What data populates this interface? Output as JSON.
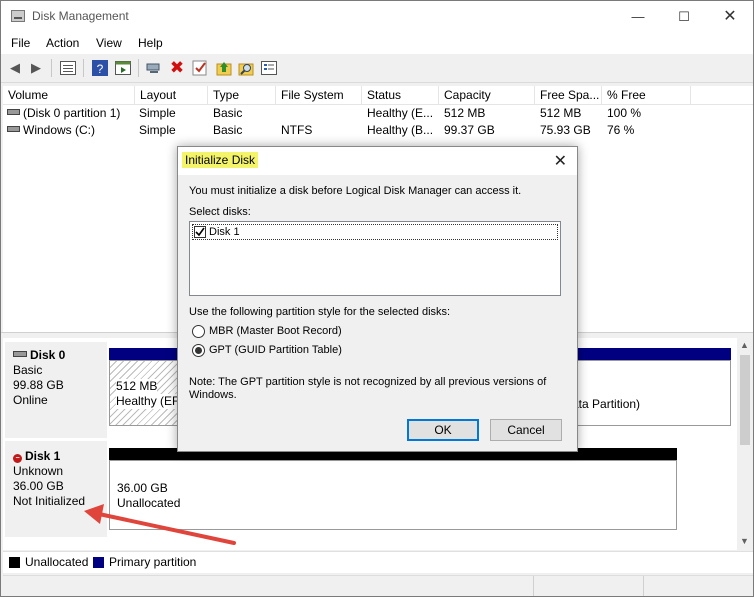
{
  "window": {
    "title": "Disk Management"
  },
  "menu": [
    "File",
    "Action",
    "View",
    "Help"
  ],
  "toolbar_icons": [
    "back-arrow-icon",
    "forward-arrow-icon",
    "list-icon",
    "help-icon",
    "properties-icon",
    "connect-icon",
    "delete-icon",
    "check-icon",
    "folder-up-icon",
    "search-icon",
    "settings-icon"
  ],
  "volume_list": {
    "columns": [
      "Volume",
      "Layout",
      "Type",
      "File System",
      "Status",
      "Capacity",
      "Free Spa...",
      "% Free"
    ],
    "rows": [
      {
        "volume": "(Disk 0 partition 1)",
        "layout": "Simple",
        "type": "Basic",
        "fs": "",
        "status": "Healthy (E...",
        "capacity": "512 MB",
        "free": "512 MB",
        "pct": "100 %"
      },
      {
        "volume": "Windows (C:)",
        "layout": "Simple",
        "type": "Basic",
        "fs": "NTFS",
        "status": "Healthy (B...",
        "capacity": "99.37 GB",
        "free": "75.93 GB",
        "pct": "76 %"
      }
    ]
  },
  "disks": [
    {
      "name": "Disk 0",
      "type": "Basic",
      "size": "99.88 GB",
      "state": "Online",
      "partitions": [
        {
          "size": "512 MB",
          "status": "Healthy (EFI"
        },
        {
          "size": "",
          "status": "ata Partition)"
        }
      ]
    },
    {
      "name": "Disk 1",
      "type": "Unknown",
      "size": "36.00 GB",
      "state": "Not Initialized",
      "partitions": [
        {
          "size": "36.00 GB",
          "status": "Unallocated"
        }
      ]
    }
  ],
  "legend": {
    "unallocated": "Unallocated",
    "primary": "Primary partition"
  },
  "colors": {
    "unallocated": "#000000",
    "primary": "#000080",
    "highlight": "#f4f46a",
    "arrow": "#e0453c",
    "default_button": "#0078d7"
  },
  "dialog": {
    "title": "Initialize Disk",
    "message": "You must initialize a disk before Logical Disk Manager can access it.",
    "select_label": "Select disks:",
    "disks": [
      {
        "label": "Disk 1",
        "checked": true
      }
    ],
    "partition_style_label": "Use the following partition style for the selected disks:",
    "options": [
      {
        "label": "MBR (Master Boot Record)",
        "selected": false
      },
      {
        "label": "GPT (GUID Partition Table)",
        "selected": true
      }
    ],
    "note": "Note: The GPT partition style is not recognized by all previous versions of Windows.",
    "ok": "OK",
    "cancel": "Cancel"
  }
}
